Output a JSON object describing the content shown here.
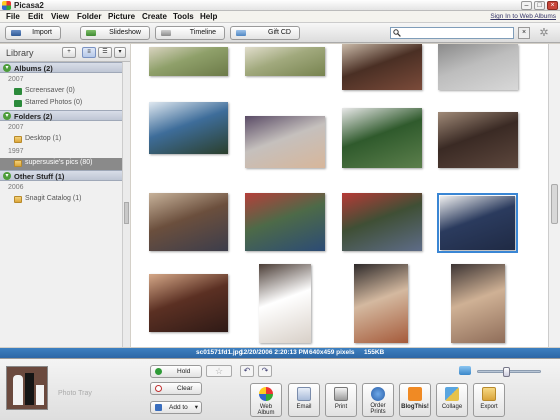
{
  "window": {
    "title": "Picasa2"
  },
  "menu": {
    "items": [
      "File",
      "Edit",
      "View",
      "Folder",
      "Picture",
      "Create",
      "Tools",
      "Help"
    ],
    "sign_in": "Sign In to Web Albums"
  },
  "toolbar": {
    "import": "Import",
    "slideshow": "Slideshow",
    "timeline": "Timeline",
    "gift_cd": "Gift CD",
    "search_placeholder": "",
    "search_value": ""
  },
  "library": {
    "title": "Library",
    "groups": {
      "albums": {
        "label": "Albums (2)",
        "year": "2007",
        "items": [
          "Screensaver (0)",
          "Starred Photos (0)"
        ]
      },
      "folders": {
        "label": "Folders (2)",
        "year1": "2007",
        "item1": "Desktop (1)",
        "year2": "1997",
        "item2": "supersusie's pics (80)"
      },
      "other": {
        "label": "Other Stuff (1)",
        "year": "2006",
        "item": "Snagit Catalog (1)"
      }
    }
  },
  "photos": [
    {
      "name": "photo-field-1",
      "colors": [
        "#8fa06a",
        "#d9d3c0",
        "#6c7a48"
      ]
    },
    {
      "name": "photo-field-2",
      "colors": [
        "#a1a97d",
        "#e1ddcc",
        "#77834f"
      ]
    },
    {
      "name": "photo-dog",
      "colors": [
        "#4a2f24",
        "#c9b9a8",
        "#7b4b3a"
      ]
    },
    {
      "name": "photo-grey-pattern",
      "colors": [
        "#bdbdbd",
        "#8a8a8a",
        "#d8d8d8"
      ]
    },
    {
      "name": "photo-lake-sky",
      "colors": [
        "#3e6d9a",
        "#dfe8f0",
        "#2b3f2c"
      ]
    },
    {
      "name": "photo-couple-sofa",
      "colors": [
        "#c5c0bd",
        "#5a4b66",
        "#d7b69a"
      ]
    },
    {
      "name": "photo-crowd",
      "colors": [
        "#2f5a2c",
        "#e8e8e8",
        "#5c7f4c"
      ]
    },
    {
      "name": "photo-cat",
      "colors": [
        "#3a2a24",
        "#a08a78",
        "#5d473d"
      ]
    },
    {
      "name": "photo-family-table",
      "colors": [
        "#6b4f3d",
        "#c7b29a",
        "#3c3d4b"
      ]
    },
    {
      "name": "photo-outdoor-group",
      "colors": [
        "#4d6a48",
        "#b53f3a",
        "#2c4b75"
      ]
    },
    {
      "name": "photo-couple-tree",
      "colors": [
        "#3f4f35",
        "#b63a36",
        "#5e6c88"
      ]
    },
    {
      "name": "photo-wedding",
      "colors": [
        "#2b3b5e",
        "#f0f0f0",
        "#1f2a44"
      ]
    },
    {
      "name": "photo-couple-closeup",
      "colors": [
        "#5b3023",
        "#d5a888",
        "#2f1a16"
      ]
    },
    {
      "name": "photo-coat",
      "colors": [
        "#ffffff",
        "#4b3d36",
        "#d8d0c8"
      ]
    },
    {
      "name": "photo-couple-standing",
      "colors": [
        "#d4b9a0",
        "#2e2a2a",
        "#a55a3a"
      ]
    },
    {
      "name": "photo-couple-standing-2",
      "colors": [
        "#cfb195",
        "#3c3433",
        "#8f6d59"
      ]
    }
  ],
  "status": {
    "filename": "sc01571fd1.jpg",
    "datetime": "12/20/2006 2:20:13 PM",
    "dimensions": "640x459 pixels",
    "size": "155KB"
  },
  "tray": {
    "label": "Photo Tray",
    "hold": "Hold",
    "clear": "Clear",
    "add_to": "Add to",
    "star": "☆",
    "rotate_left": "↶",
    "rotate_right": "↷",
    "zoom_level": 0.45
  },
  "share": [
    "Web Album",
    "Email",
    "Print",
    "Order Prints",
    "BlogThis!",
    "Collage",
    "Export"
  ]
}
